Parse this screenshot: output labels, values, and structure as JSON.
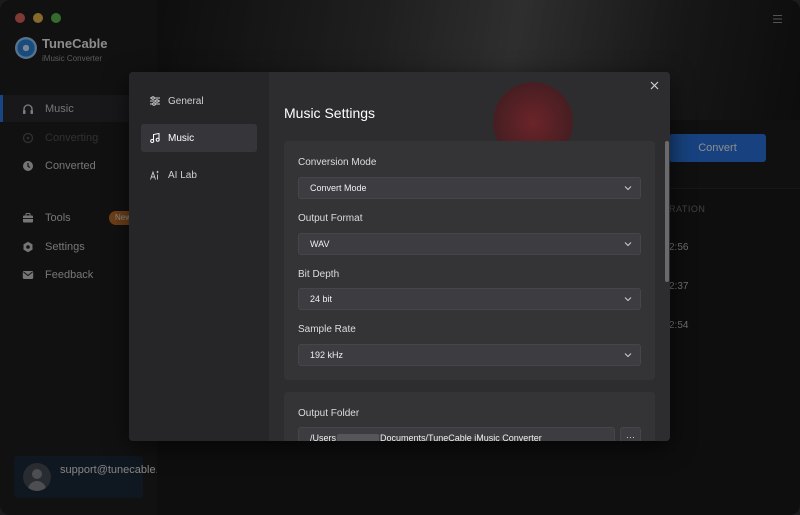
{
  "app": {
    "title": "TuneCable",
    "subtitle": "iMusic Converter",
    "traffic_colors": [
      "#ec6a5e",
      "#f4bf4f",
      "#61c554"
    ]
  },
  "sidebar": {
    "items": [
      {
        "label": "Music",
        "icon": "headphones-icon",
        "active": true
      },
      {
        "label": "Converting",
        "icon": "sync-icon",
        "dim": true
      },
      {
        "label": "Converted",
        "icon": "clock-icon"
      },
      {
        "label": "Tools",
        "icon": "toolbox-icon",
        "badge": "New"
      },
      {
        "label": "Settings",
        "icon": "gear-icon"
      },
      {
        "label": "Feedback",
        "icon": "mail-icon"
      }
    ],
    "account": {
      "email": "support@tunecable.com"
    }
  },
  "background": {
    "convert_label": "Convert",
    "duration_header": "URATION",
    "durations": [
      "2:56",
      "2:37",
      "2:54"
    ]
  },
  "dialog": {
    "tabs": [
      {
        "label": "General",
        "icon": "sliders-icon"
      },
      {
        "label": "Music",
        "icon": "music-note-icon",
        "active": true
      },
      {
        "label": "AI Lab",
        "icon": "ai-icon"
      }
    ],
    "title": "Music Settings",
    "fields": [
      {
        "label": "Conversion Mode",
        "value": "Convert Mode"
      },
      {
        "label": "Output Format",
        "value": "WAV"
      },
      {
        "label": "Bit Depth",
        "value": "24 bit"
      },
      {
        "label": "Sample Rate",
        "value": "192 kHz"
      }
    ],
    "output_folder": {
      "label": "Output Folder",
      "path_prefix": "/Users",
      "path_suffix": "Documents/TuneCable iMusic Converter",
      "browse_label": "···"
    }
  },
  "colors": {
    "accent": "#2a78e8",
    "badge": "#c8762a"
  }
}
